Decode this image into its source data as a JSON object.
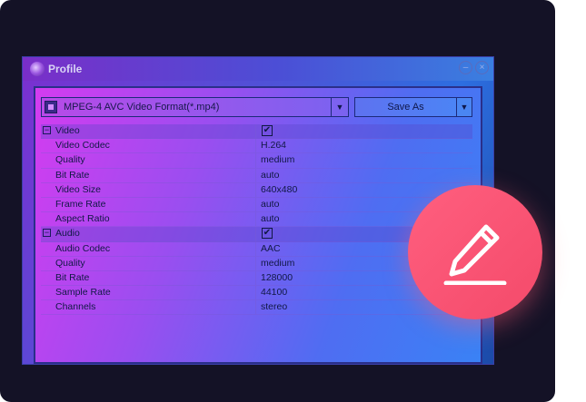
{
  "window": {
    "title": "Profile"
  },
  "toolbar": {
    "format_value": "MPEG-4 AVC Video Format(*.mp4)",
    "save_as_label": "Save As"
  },
  "groups": {
    "video": {
      "label": "Video",
      "checked": "✔",
      "rows": [
        {
          "name": "Video Codec",
          "value": "H.264"
        },
        {
          "name": "Quality",
          "value": "medium"
        },
        {
          "name": "Bit Rate",
          "value": "auto"
        },
        {
          "name": "Video Size",
          "value": "640x480"
        },
        {
          "name": "Frame Rate",
          "value": "auto"
        },
        {
          "name": "Aspect Ratio",
          "value": "auto"
        }
      ]
    },
    "audio": {
      "label": "Audio",
      "checked": "✔",
      "rows": [
        {
          "name": "Audio Codec",
          "value": "AAC"
        },
        {
          "name": "Quality",
          "value": "medium"
        },
        {
          "name": "Bit Rate",
          "value": "128000"
        },
        {
          "name": "Sample Rate",
          "value": "44100"
        },
        {
          "name": "Channels",
          "value": "stereo"
        }
      ]
    }
  },
  "icons": {
    "title": "profile-disc-icon",
    "minimize": "minimize-icon",
    "close": "close-icon",
    "format": "video-format-icon",
    "edit": "pencil-icon"
  },
  "colors": {
    "card_bg": "#141226",
    "accent_edit": "#f44a6a"
  }
}
